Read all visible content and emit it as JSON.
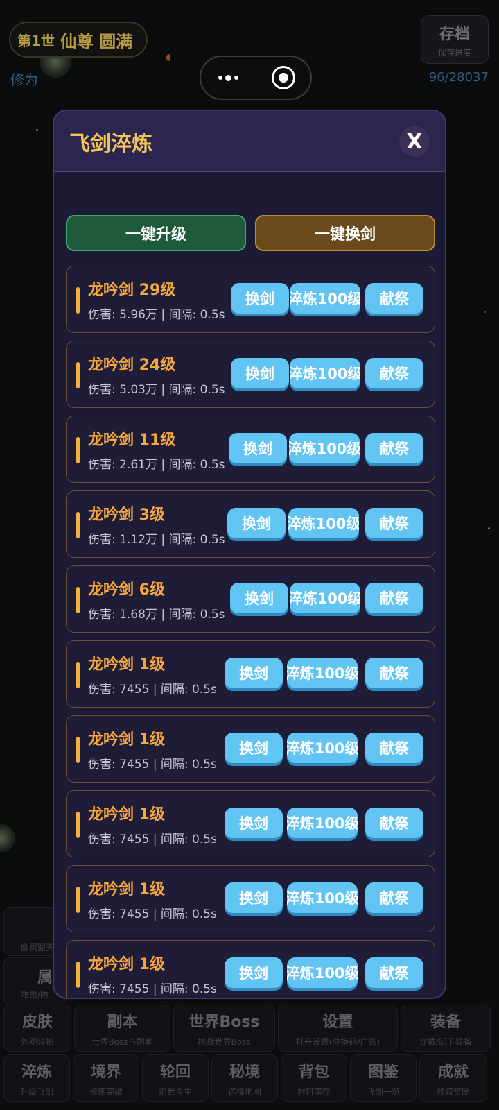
{
  "header": {
    "generation": "第1世",
    "rank": "仙尊 圆满",
    "cultivation_label": "修为",
    "cultivation_value": "96/28037",
    "save_title": "存档",
    "save_sub": "保存进度"
  },
  "capsule": {
    "menu_icon": "more-dots-icon",
    "close_icon": "target-circle-icon"
  },
  "modal": {
    "title": "飞剑淬炼",
    "close_label": "X",
    "upgrade_all_label": "一键升级",
    "swap_all_label": "一键换剑",
    "swords": [
      {
        "name": "龙吟剑 29级",
        "stats": "伤害: 5.96万 | 间隔: 0.5s",
        "swap": "换剑",
        "refine": "淬炼100级",
        "offer": "献祭"
      },
      {
        "name": "龙吟剑 24级",
        "stats": "伤害: 5.03万 | 间隔: 0.5s",
        "swap": "换剑",
        "refine": "淬炼100级",
        "offer": "献祭"
      },
      {
        "name": "龙吟剑 11级",
        "stats": "伤害: 2.61万 | 间隔: 0.5s",
        "swap": "换剑",
        "refine": "淬炼100级",
        "offer": "献祭"
      },
      {
        "name": "龙吟剑 3级",
        "stats": "伤害: 1.12万 | 间隔: 0.5s",
        "swap": "换剑",
        "refine": "淬炼100级",
        "offer": "献祭"
      },
      {
        "name": "龙吟剑 6级",
        "stats": "伤害: 1.68万 | 间隔: 0.5s",
        "swap": "换剑",
        "refine": "淬炼100级",
        "offer": "献祭"
      },
      {
        "name": "龙吟剑 1级",
        "stats": "伤害: 7455 | 间隔: 0.5s",
        "swap": "换剑",
        "refine": "淬炼100级",
        "offer": "献祭"
      },
      {
        "name": "龙吟剑 1级",
        "stats": "伤害: 7455 | 间隔: 0.5s",
        "swap": "换剑",
        "refine": "淬炼100级",
        "offer": "献祭"
      },
      {
        "name": "龙吟剑 1级",
        "stats": "伤害: 7455 | 间隔: 0.5s",
        "swap": "换剑",
        "refine": "淬炼100级",
        "offer": "献祭"
      },
      {
        "name": "龙吟剑 1级",
        "stats": "伤害: 7455 | 间隔: 0.5s",
        "swap": "换剑",
        "refine": "淬炼100级",
        "offer": "献祭"
      },
      {
        "name": "龙吟剑 1级",
        "stats": "伤害: 7455 | 间隔: 0.5s",
        "swap": "换剑",
        "refine": "淬炼100级",
        "offer": "献祭"
      }
    ]
  },
  "bottom_nav": {
    "partial_a_sub": "幽冥盟天",
    "partial_b_title": "属",
    "partial_b_sub": "攻击/防",
    "row1": [
      {
        "title": "皮肤",
        "sub": "外观装扮"
      },
      {
        "title": "副本",
        "sub": "世界Boss与副本"
      },
      {
        "title": "世界Boss",
        "sub": "挑战世界Boss"
      },
      {
        "title": "设置",
        "sub": "打开设置(兑换码/广告)"
      },
      {
        "title": "装备",
        "sub": "穿戴/卸下装备"
      }
    ],
    "row2": [
      {
        "title": "淬炼",
        "sub": "升级飞剑"
      },
      {
        "title": "境界",
        "sub": "修炼突破"
      },
      {
        "title": "轮回",
        "sub": "前世今生"
      },
      {
        "title": "秘境",
        "sub": "选择地图"
      },
      {
        "title": "背包",
        "sub": "材料库存"
      },
      {
        "title": "图鉴",
        "sub": "飞剑一览"
      },
      {
        "title": "成就",
        "sub": "领取奖励"
      }
    ]
  }
}
